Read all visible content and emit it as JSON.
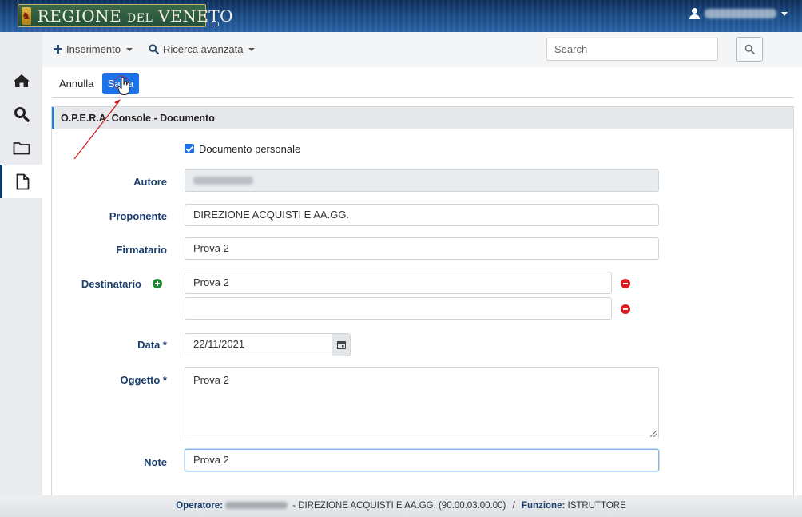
{
  "header": {
    "logo_text": "REGIONE DEL VENETO",
    "version": "1.0",
    "user_name_redacted": "DI LISA DAVIDE"
  },
  "toolbar": {
    "inserimento_label": "Inserimento",
    "ricerca_label": "Ricerca avanzata",
    "search_placeholder": "Search"
  },
  "actions": {
    "annulla_label": "Annulla",
    "salva_label": "Salva"
  },
  "panel": {
    "title": "O.P.E.R.A. Console - Documento",
    "checkbox_label": "Documento personale",
    "checkbox_checked": true,
    "fields": {
      "autore": {
        "label": "Autore",
        "value": "DI LISA DAVIDE"
      },
      "proponente": {
        "label": "Proponente",
        "value": "DIREZIONE ACQUISTI E AA.GG."
      },
      "firmatario": {
        "label": "Firmatario",
        "value": "Prova 2"
      },
      "destinatario": {
        "label": "Destinatario",
        "values": [
          "Prova 2",
          ""
        ]
      },
      "data": {
        "label": "Data *",
        "value": "22/11/2021"
      },
      "oggetto": {
        "label": "Oggetto *",
        "value": "Prova 2"
      },
      "note": {
        "label": "Note",
        "value": "Prova 2"
      }
    }
  },
  "footer": {
    "operatore_label": "Operatore:",
    "operatore_redacted": "DI LISA DAVIDE",
    "operatore_detail": " - DIREZIONE ACQUISTI E AA.GG. (90.00.03.00.00)",
    "separator": "/",
    "funzione_label": "Funzione:",
    "funzione_value": "ISTRUTTORE"
  },
  "colors": {
    "primary_button": "#1a73e8",
    "header_blue": "#1a4a82",
    "label_blue": "#1c3f6e",
    "add_green": "#1e8a32",
    "remove_red": "#d8201e"
  },
  "icons": [
    "home-icon",
    "search-icon",
    "folder-icon",
    "document-icon",
    "plus-icon",
    "calendar-icon",
    "user-icon"
  ]
}
